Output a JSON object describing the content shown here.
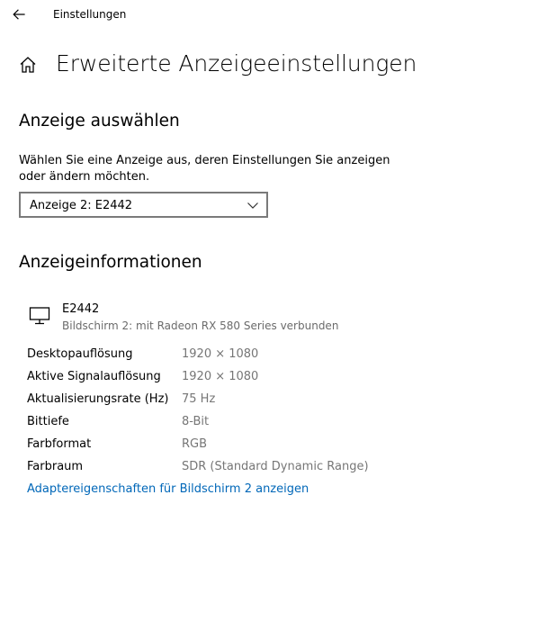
{
  "header": {
    "back_icon": "arrow-left-icon",
    "app_title": "Einstellungen"
  },
  "page": {
    "home_icon": "home-icon",
    "title": "Erweiterte Anzeigeeinstellungen"
  },
  "select_display": {
    "heading": "Anzeige auswählen",
    "description": "Wählen Sie eine Anzeige aus, deren Einstellungen Sie anzeigen oder ändern möchten.",
    "selected": "Anzeige 2: E2442"
  },
  "display_info": {
    "heading": "Anzeigeinformationen",
    "monitor_icon": "monitor-icon",
    "name": "E2442",
    "subtitle": "Bildschirm 2: mit Radeon RX 580 Series verbunden",
    "rows": [
      {
        "label": "Desktopauflösung",
        "value": "1920 × 1080"
      },
      {
        "label": "Aktive Signalauflösung",
        "value": "1920 × 1080"
      },
      {
        "label": "Aktualisierungsrate (Hz)",
        "value": "75 Hz"
      },
      {
        "label": "Bittiefe",
        "value": "8-Bit"
      },
      {
        "label": "Farbformat",
        "value": "RGB"
      },
      {
        "label": "Farbraum",
        "value": "SDR (Standard Dynamic Range)"
      }
    ],
    "link": "Adaptereigenschaften für Bildschirm 2 anzeigen"
  },
  "colors": {
    "link": "#0067b8",
    "secondary_text": "#767676",
    "border": "#7a7a7a"
  }
}
